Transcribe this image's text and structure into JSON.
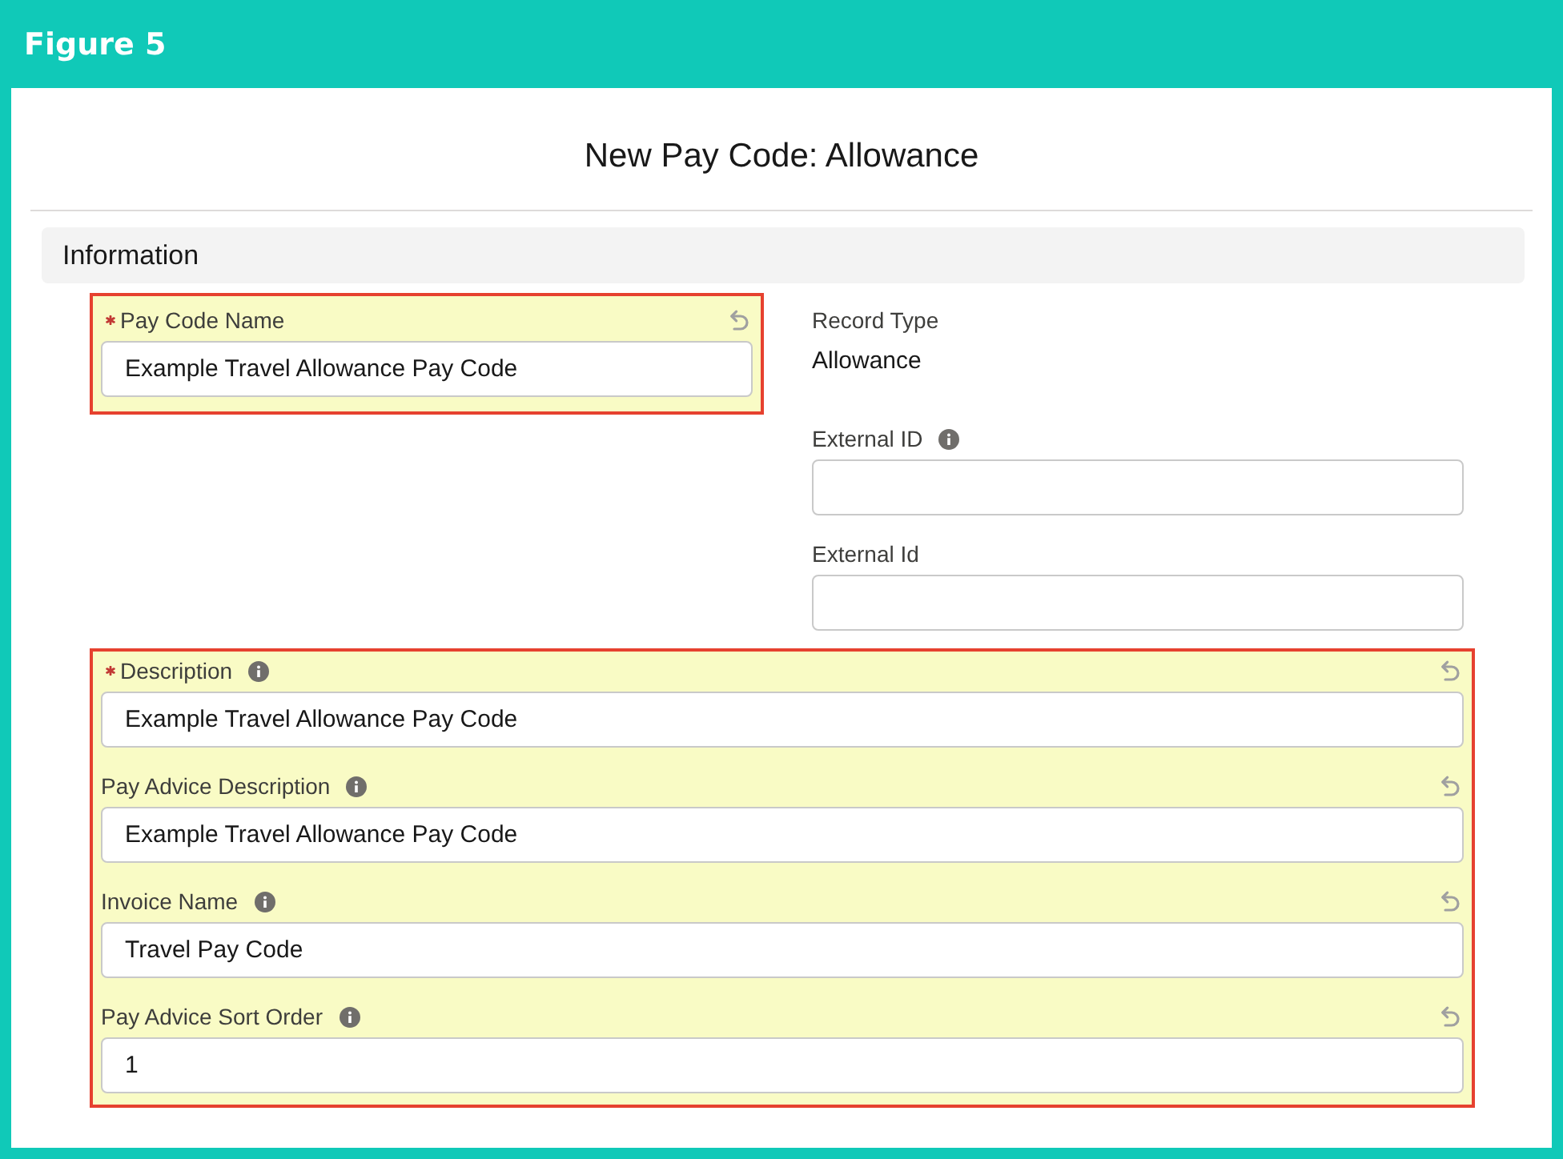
{
  "figure": {
    "caption": "Figure 5"
  },
  "modal": {
    "title": "New Pay Code: Allowance"
  },
  "section": {
    "title": "Information"
  },
  "left_group": {
    "highlighted": true,
    "fields": [
      {
        "kind": "input",
        "label": "Pay Code Name",
        "required": true,
        "info": false,
        "edited": true,
        "value": "Example Travel Allowance Pay Code"
      }
    ]
  },
  "right_group": {
    "highlighted": false,
    "fields": [
      {
        "kind": "readonly",
        "label": "Record Type",
        "required": false,
        "info": false,
        "edited": false,
        "value": "Allowance"
      },
      {
        "kind": "input",
        "label": "External ID",
        "required": false,
        "info": true,
        "edited": false
      },
      {
        "kind": "input",
        "label": "External Id",
        "required": false,
        "info": false,
        "edited": false
      }
    ]
  },
  "wide_group": {
    "highlighted": true,
    "fields": [
      {
        "kind": "input",
        "label": "Description",
        "required": true,
        "info": true,
        "edited": true,
        "value": "Example Travel Allowance Pay Code"
      },
      {
        "kind": "input",
        "label": "Pay Advice Description",
        "required": false,
        "info": true,
        "edited": true,
        "value": "Example Travel Allowance Pay Code"
      },
      {
        "kind": "input",
        "label": "Invoice Name",
        "required": false,
        "info": true,
        "edited": true,
        "value": "Travel Pay Code"
      },
      {
        "kind": "input",
        "label": "Pay Advice Sort Order",
        "required": false,
        "info": true,
        "edited": true,
        "value": "1"
      }
    ]
  }
}
